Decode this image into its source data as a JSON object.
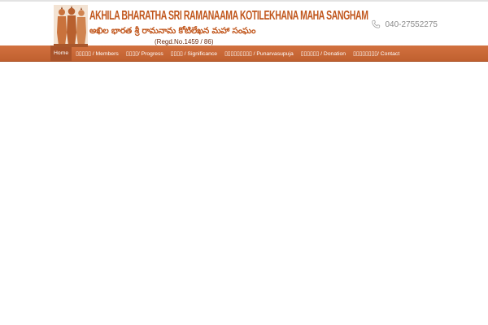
{
  "header": {
    "logo": {
      "title": "AKHILA  BHARATHA SRI RAMANAAMA KOTILEKHANA MAHA SANGHAM",
      "subtitle_telugu": "అఖిల భారత శ్రీ రామనామ కోటిలేఖన మహా సంఘం",
      "registration": "(Regd.No.1459 / 86)"
    },
    "phone": {
      "icon": "phone-icon",
      "number": "040-27552275"
    }
  },
  "nav": {
    "items": [
      {
        "label": "Home",
        "active": true
      },
      {
        "label": "▯▯▯▯▯ / Members",
        "active": false
      },
      {
        "label": "▯▯▯▯/ Progress",
        "active": false
      },
      {
        "label": "▯▯▯▯ / Significance",
        "active": false
      },
      {
        "label": "▯▯▯▯▯▯▯▯▯ / Punarvasupuja",
        "active": false
      },
      {
        "label": "▯▯▯▯▯▯ / Donation",
        "active": false
      },
      {
        "label": "▯▯▯▯▯▯▯▯/ Contact",
        "active": false
      }
    ]
  },
  "colors": {
    "brand": "#c1571d",
    "nav_bg": "#c8683a",
    "nav_active": "#a9532a"
  }
}
